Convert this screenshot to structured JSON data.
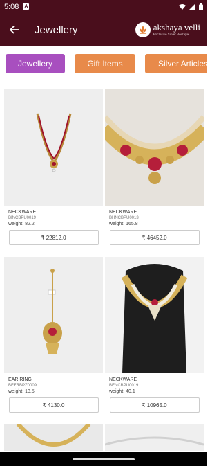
{
  "status_bar": {
    "time": "5:08",
    "notif_badge": "A"
  },
  "header": {
    "title": "Jewellery",
    "logo": {
      "name": "akshaya velli",
      "tagline": "Exclusive Silver Boutique"
    }
  },
  "tabs": [
    {
      "label": "Jewellery",
      "active": true
    },
    {
      "label": "Gift Items",
      "active": false
    },
    {
      "label": "Silver Articles",
      "active": false
    }
  ],
  "products": [
    {
      "category": "NECKWARE",
      "code": "BINCBPU0019",
      "weight": "weight: 82.2",
      "price": "₹ 22812.0"
    },
    {
      "category": "NECKWARE",
      "code": "BHNCBPU0013",
      "weight": "weight: 165.8",
      "price": "₹ 46452.0"
    },
    {
      "category": "EAR RING",
      "code": "BFERBPZ0009",
      "weight": "weight: 13.5",
      "price": "₹ 4130.0"
    },
    {
      "category": "NECKWARE",
      "code": "BENCBPU0019",
      "weight": "weight: 40.1",
      "price": "₹ 10965.0"
    }
  ],
  "colors": {
    "header": "#4a0e1c",
    "tab_active": "#a84fbf",
    "tab_inactive": "#e88a4a"
  }
}
